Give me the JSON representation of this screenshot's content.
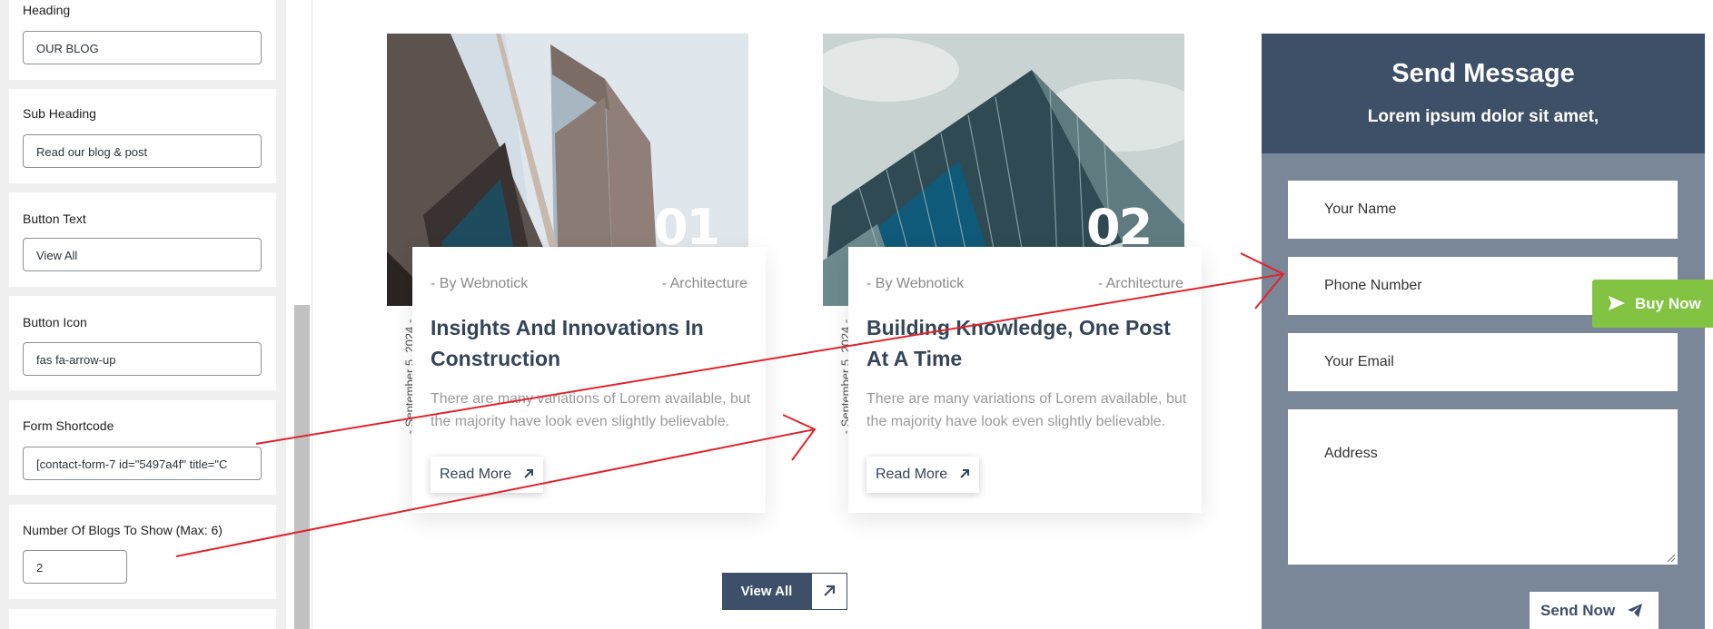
{
  "editor": {
    "fields": [
      {
        "label": "Heading",
        "value": "OUR BLOG"
      },
      {
        "label": "Sub Heading",
        "value": "Read our blog & post"
      },
      {
        "label": "Button Text",
        "value": "View All"
      },
      {
        "label": "Button Icon",
        "value": "fas fa-arrow-up"
      },
      {
        "label": "Form Shortcode",
        "value": "[contact-form-7 id=\"5497a4f\" title=\"C"
      },
      {
        "label": "Number Of Blogs To Show (Max: 6)",
        "value": "2"
      }
    ]
  },
  "blog": {
    "cards": [
      {
        "number": "01",
        "author": "- By Webnotick",
        "category": "- Architecture",
        "title": "Insights And Innovations In Construction",
        "excerpt": "There are many variations of Lorem available, but the majority have look even slightly believable.",
        "date": "- September 5, 2024 -",
        "read_more": "Read More"
      },
      {
        "number": "02",
        "author": "- By Webnotick",
        "category": "- Architecture",
        "title": "Building Knowledge, One Post At A Time",
        "excerpt": "There are many variations of Lorem available, but the majority have look even slightly believable.",
        "date": "- September 5, 2024 -",
        "read_more": "Read More"
      }
    ],
    "view_all": "View All"
  },
  "form": {
    "heading": "Send Message",
    "subheading": "Lorem ipsum dolor sit amet,",
    "name_placeholder": "Your Name",
    "phone_placeholder": "Phone Number",
    "email_placeholder": "Your Email",
    "address_placeholder": "Address",
    "submit": "Send Now"
  },
  "buy_now": "Buy Now",
  "colors": {
    "navy": "#3e5068",
    "form_body": "#7a8799",
    "buy_green": "#82c341",
    "annotation_red": "#e0242b"
  },
  "icons": [
    "arrow-up-right-icon",
    "send-icon",
    "resize-grip-icon",
    "red-annotation-arrow"
  ]
}
